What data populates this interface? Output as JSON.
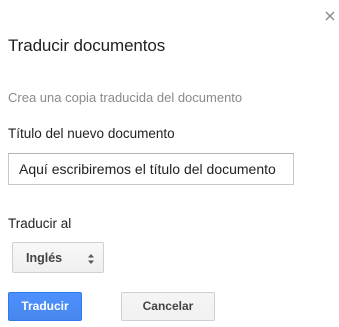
{
  "dialog": {
    "title": "Traducir documentos",
    "subtitle": "Crea una copia traducida del documento",
    "close_icon": "close-icon"
  },
  "name_field": {
    "label": "Título del nuevo documento",
    "value": "Aquí escribiremos el título del documento"
  },
  "language_field": {
    "label": "Traducir al",
    "selected": "Inglés",
    "arrows_icon": "up-down-arrows-icon"
  },
  "buttons": {
    "translate_label": "Traducir",
    "cancel_label": "Cancelar"
  },
  "colors": {
    "primary_button": "#4d90fe",
    "subtitle_text": "#8a8a8a"
  }
}
